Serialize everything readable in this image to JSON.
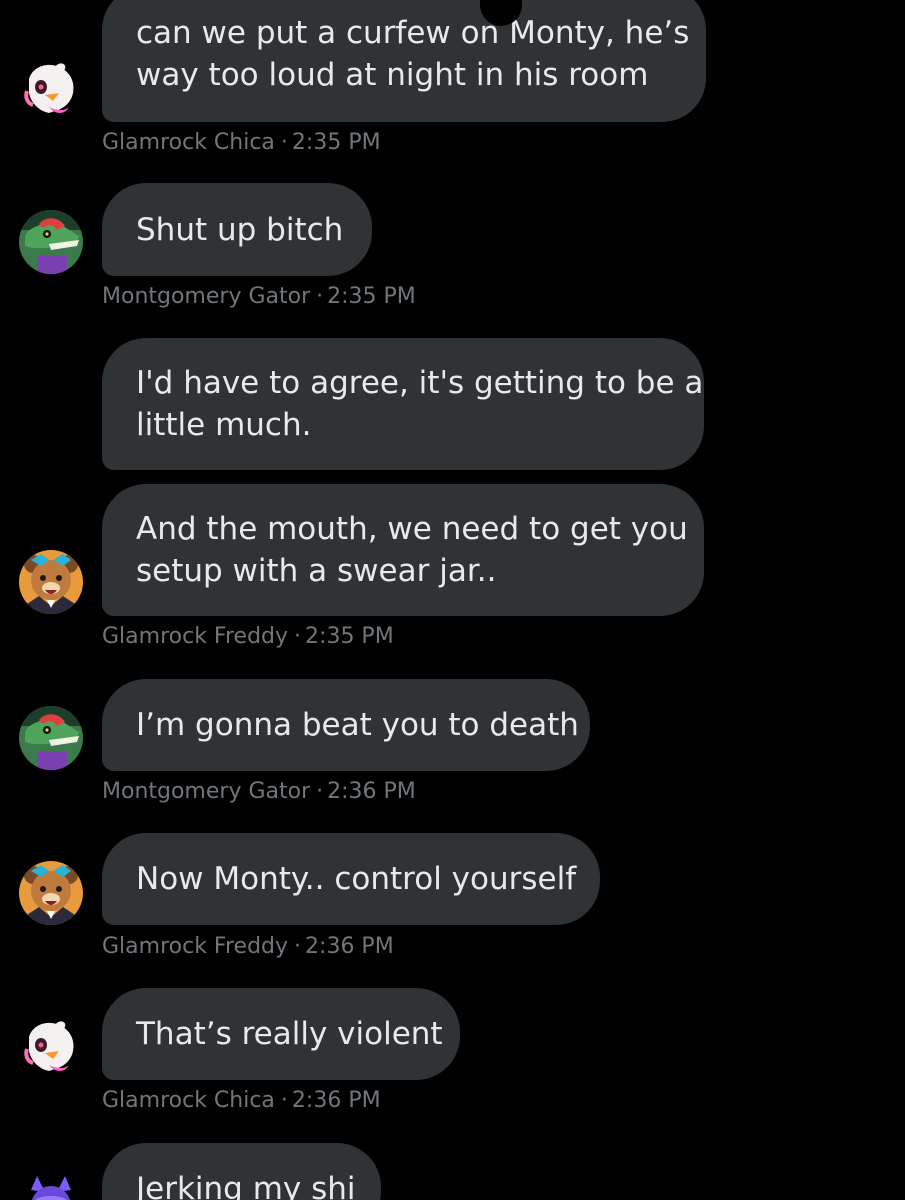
{
  "messages": [
    {
      "lines": [
        "can we put a curfew on Monty, he’s",
        "way too loud at night in his room"
      ],
      "sender": "Glamrock Chica",
      "time": "2:35 PM",
      "avatar": "chica-avatar"
    },
    {
      "lines": [
        "Shut up bitch"
      ],
      "sender": "Montgomery Gator",
      "time": "2:35 PM",
      "avatar": "monty-avatar"
    },
    {
      "lines": [
        "I'd have to agree, it's getting to be a",
        "little much."
      ],
      "avatar": "freddy-avatar"
    },
    {
      "lines": [
        "And the mouth, we need to get you",
        "setup with a swear jar.."
      ],
      "sender": "Glamrock Freddy",
      "time": "2:35 PM",
      "avatar": "freddy-avatar"
    },
    {
      "lines": [
        "I’m gonna beat you to death"
      ],
      "sender": "Montgomery Gator",
      "time": "2:36 PM",
      "avatar": "monty-avatar"
    },
    {
      "lines": [
        "Now Monty.. control yourself"
      ],
      "sender": "Glamrock Freddy",
      "time": "2:36 PM",
      "avatar": "freddy-avatar"
    },
    {
      "lines": [
        "That’s really violent"
      ],
      "sender": "Glamrock Chica",
      "time": "2:36 PM",
      "avatar": "chica-avatar"
    },
    {
      "lines": [
        "Jerking my shi"
      ],
      "avatar": "roxy-avatar"
    }
  ],
  "meta_separator": "·",
  "colors": {
    "background": "#000000",
    "bubble": "#2f3336",
    "bubble_text": "#e7e9ea",
    "meta_text": "#71767b"
  }
}
